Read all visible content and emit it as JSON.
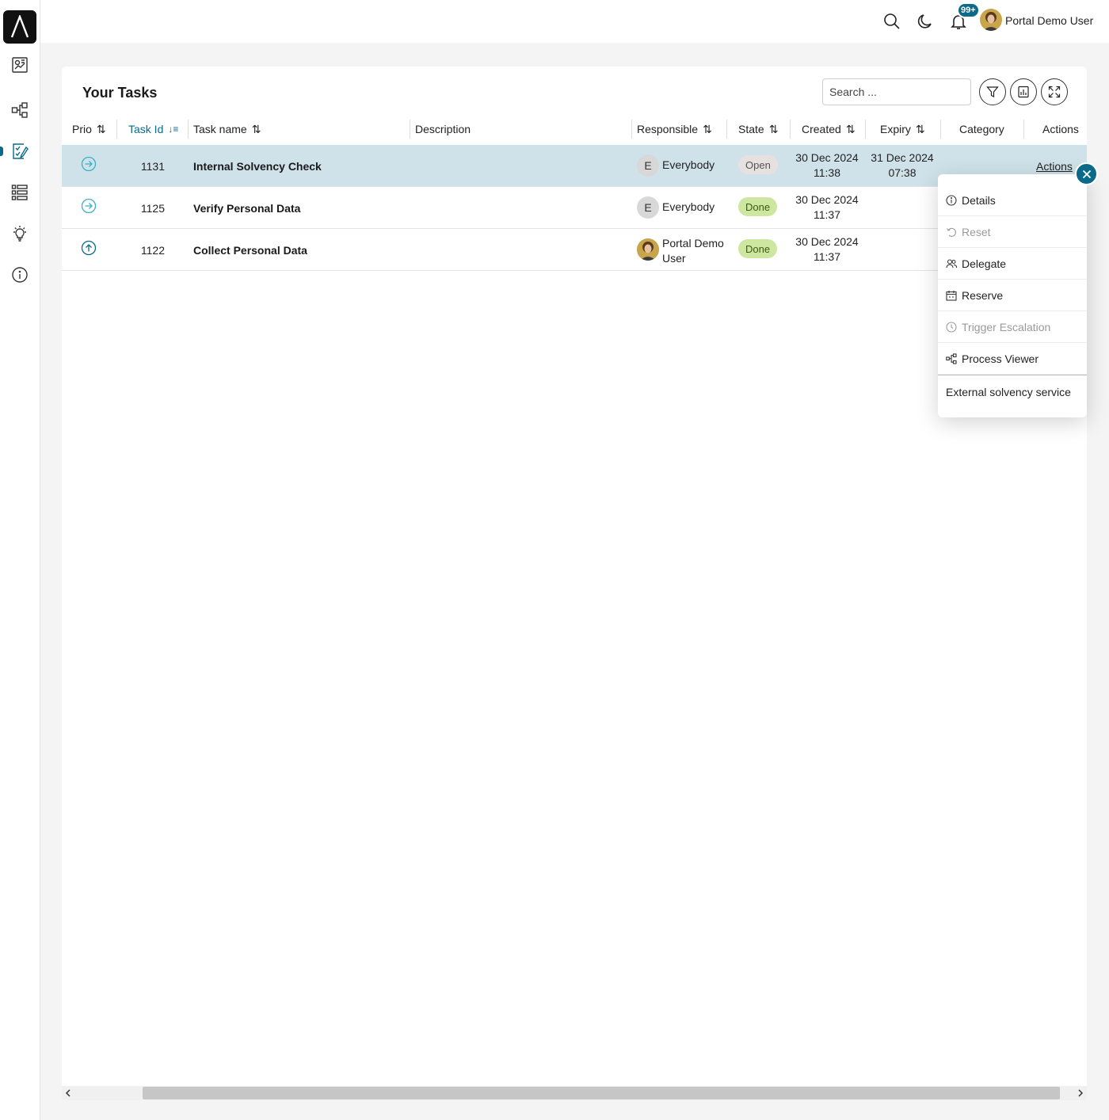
{
  "topbar": {
    "notification_badge": "99+",
    "user_name": "Portal Demo User"
  },
  "sidebar": {
    "items": [
      "dashboard-icon",
      "process-icon",
      "tasks-icon",
      "list-icon",
      "lightbulb-icon",
      "info-icon"
    ],
    "active": "tasks-icon"
  },
  "widget": {
    "title": "Your Tasks",
    "search_placeholder": "Search ..."
  },
  "table": {
    "columns": {
      "prio": "Prio",
      "task_id": "Task Id",
      "task_name": "Task name",
      "description": "Description",
      "responsible": "Responsible",
      "state": "State",
      "created": "Created",
      "expiry": "Expiry",
      "category": "Category",
      "actions": "Actions"
    },
    "rows": [
      {
        "prio": "normal",
        "id": "1131",
        "name": "Internal Solvency Check",
        "description": "",
        "responsible_initial": "E",
        "responsible": "Everybody",
        "state": "Open",
        "created_date": "30 Dec 2024",
        "created_time": "11:38",
        "expiry_date": "31 Dec 2024",
        "expiry_time": "07:38",
        "category": "",
        "actions_label": "Actions"
      },
      {
        "prio": "normal",
        "id": "1125",
        "name": "Verify Personal Data",
        "description": "",
        "responsible_initial": "E",
        "responsible": "Everybody",
        "state": "Done",
        "created_date": "30 Dec 2024",
        "created_time": "11:37",
        "expiry_date": "",
        "expiry_time": "",
        "category": "",
        "actions_label": ""
      },
      {
        "prio": "high",
        "id": "1122",
        "name": "Collect Personal Data",
        "description": "",
        "responsible": "Portal Demo User",
        "state": "Done",
        "created_date": "30 Dec 2024",
        "created_time": "11:37",
        "expiry_date": "",
        "expiry_time": "",
        "category": "",
        "actions_label": ""
      }
    ]
  },
  "action_menu": {
    "items": [
      {
        "label": "Details",
        "icon": "info-icon",
        "disabled": false
      },
      {
        "label": "Reset",
        "icon": "reset-icon",
        "disabled": true
      },
      {
        "label": "Delegate",
        "icon": "users-icon",
        "disabled": false
      },
      {
        "label": "Reserve",
        "icon": "calendar-icon",
        "disabled": false
      },
      {
        "label": "Trigger Escalation",
        "icon": "clock-icon",
        "disabled": true
      },
      {
        "label": "Process Viewer",
        "icon": "process-icon",
        "disabled": false
      }
    ],
    "extra": "External solvency service"
  },
  "colors": {
    "accent": "#0b6a8a",
    "selected_row": "#cfe2ea",
    "state_open": "#e7e0e0",
    "state_done": "#cde6a0",
    "prio_normal": "#3bb0c9",
    "prio_high": "#0b6a8a"
  }
}
